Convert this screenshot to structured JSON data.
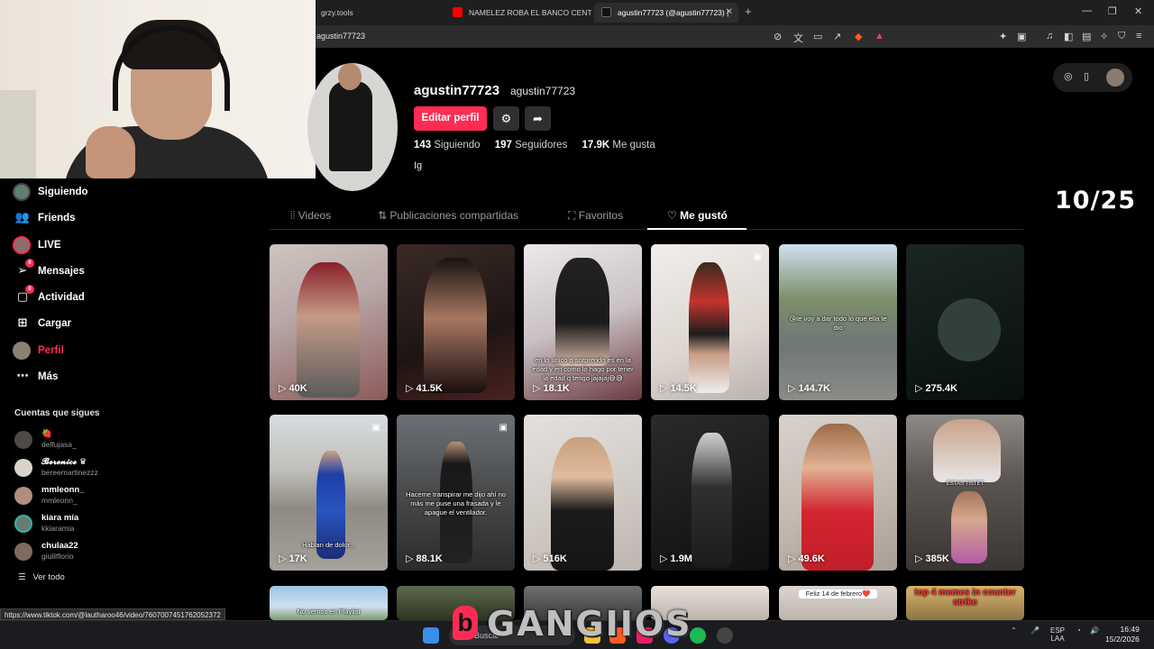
{
  "browser": {
    "tabs": [
      {
        "label": "grzy.tools",
        "active": false
      },
      {
        "label": "NAMELEZ ROBA EL BANCO CENTRAL",
        "active": false
      },
      {
        "label": "agustin77723 (@agustin77723) |",
        "active": true
      }
    ],
    "address": "agustin77723"
  },
  "profile": {
    "username": "agustin77723",
    "nickname": "agustin77723",
    "edit_label": "Editar perfil",
    "following_count": "143",
    "following_label": "Siguiendo",
    "followers_count": "197",
    "followers_label": "Seguidores",
    "likes_count": "17.9K",
    "likes_label": "Me gusta",
    "bio": "Ig"
  },
  "overlay_counter": "10/25",
  "tabs": [
    {
      "label": "Videos",
      "icon": "grid-icon"
    },
    {
      "label": "Publicaciones compartidas",
      "icon": "repost-icon"
    },
    {
      "label": "Favoritos",
      "icon": "bookmark-icon"
    },
    {
      "label": "Me gustó",
      "icon": "heart-icon",
      "active": true
    }
  ],
  "sidebar": {
    "items": [
      {
        "label": "Siguiendo",
        "icon": "following-avatar-icon"
      },
      {
        "label": "Friends",
        "icon": "friends-icon"
      },
      {
        "label": "LIVE",
        "icon": "live-icon"
      },
      {
        "label": "Mensajes",
        "icon": "messages-icon",
        "badge": "8"
      },
      {
        "label": "Actividad",
        "icon": "activity-icon",
        "badge": "8"
      },
      {
        "label": "Cargar",
        "icon": "upload-icon"
      },
      {
        "label": "Perfil",
        "icon": "profile-avatar-icon",
        "active": true
      },
      {
        "label": "Más",
        "icon": "more-icon"
      }
    ],
    "following_header": "Cuentas que sigues",
    "following": [
      {
        "name": "🍓",
        "handle": "delfujasa_"
      },
      {
        "name": "𝓑𝓮𝓻𝓮𝓷𝓲𝓬𝓮 ♛",
        "handle": "bereemartinezzz"
      },
      {
        "name": "mmleonn_",
        "handle": "mmleonn_"
      },
      {
        "name": "kiara mía",
        "handle": "kkiaramia"
      },
      {
        "name": "chulaa22",
        "handle": "giulilflorio"
      }
    ],
    "see_all": "Ver todo"
  },
  "videos": [
    {
      "views": "40K",
      "caption": ""
    },
    {
      "views": "41.5K",
      "caption": ""
    },
    {
      "views": "18.1K",
      "caption": "en lo unico q sorprendo es en la edad y en como lo hago por tener la edad q tengo jajajaj😅😅"
    },
    {
      "views": "14.5K",
      "caption": "",
      "pinned": true
    },
    {
      "views": "144.7K",
      "caption": "😘te voy a dar todo lo que ella te dio"
    },
    {
      "views": "275.4K",
      "caption": ""
    },
    {
      "views": "17K",
      "caption": "Hablan de dolor...",
      "pinned": true
    },
    {
      "views": "88.1K",
      "caption": "Haceme transpirar me dijo ahí no más me puse una frasada y le apague el ventilador.",
      "pinned": true
    },
    {
      "views": "516K",
      "caption": ""
    },
    {
      "views": "1.9M",
      "caption": ""
    },
    {
      "views": "49.6K",
      "caption": ""
    },
    {
      "views": "385K",
      "caption": "ESTAS TISTET"
    },
    {
      "views": "",
      "caption": "No vemos en Playlist"
    },
    {
      "views": "",
      "caption": ""
    },
    {
      "views": "",
      "caption": ""
    },
    {
      "views": "",
      "caption": ""
    },
    {
      "views": "",
      "caption": "Feliz 14 de febrero❤️"
    },
    {
      "views": "",
      "caption": "top 4 memes in counter strike"
    }
  ],
  "status_url": "https://www.tiktok.com/@lautharoo46/video/7607007451762052372",
  "taskbar": {
    "search": "Buscar",
    "lang": "ESP",
    "lang2": "LAA",
    "time": "16:49",
    "date": "15/2/2026"
  },
  "watermark": "GANGIIOS"
}
